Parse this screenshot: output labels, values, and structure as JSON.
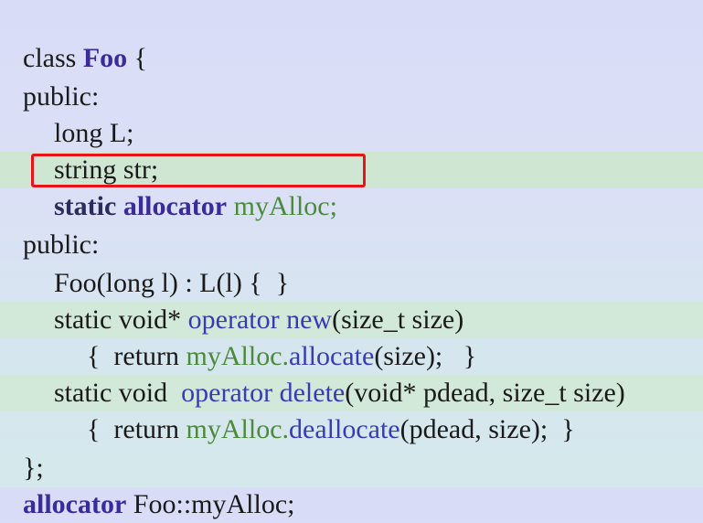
{
  "lines": {
    "l1_a": "class ",
    "l1_b": "Foo",
    "l1_c": " {",
    "l2": "public:",
    "l3": "long L;",
    "l4": "string str;",
    "l5_a": "static ",
    "l5_b": "allocator",
    "l5_c": " myAlloc;",
    "l6": "public:",
    "l7": "Foo(long l) : L(l) {  }",
    "l8_a": "static void* ",
    "l8_b": "operator new",
    "l8_c": "(size_t size)",
    "l9_a": "{  return ",
    "l9_b": "myAlloc.",
    "l9_c": "allocate",
    "l9_d": "(size);   }",
    "l10_a": "static void  ",
    "l10_b": "operator delete",
    "l10_c": "(void* pdead, size_t size)",
    "l11_a": "{  return ",
    "l11_b": "myAlloc.",
    "l11_c": "deallocate",
    "l11_d": "(pdead, size);  }",
    "l12": "};",
    "l13_a": "allocator",
    "l13_b": " Foo::myAlloc;"
  },
  "colors": {
    "keyword": "#3a2a9a",
    "blue": "#3a3ab8",
    "green": "#4a8a3a",
    "highlight_box": "#e8141c",
    "highlight_band": "#cfe8d0"
  }
}
